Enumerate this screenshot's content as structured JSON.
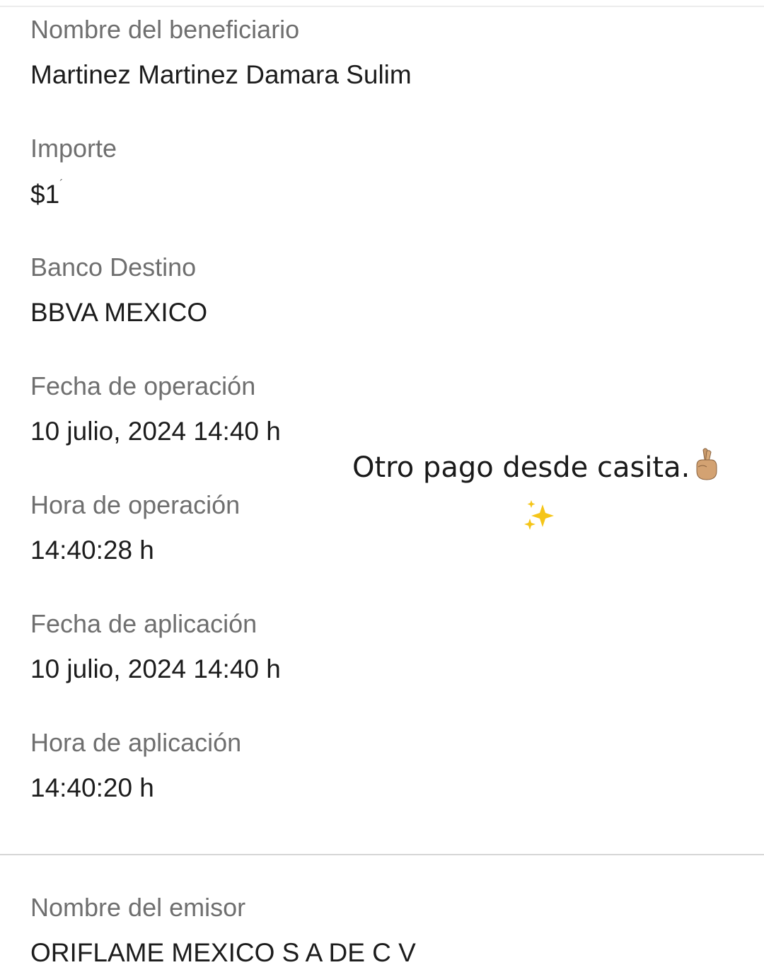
{
  "fields": [
    {
      "label": "Nombre del beneficiario",
      "value": "Martinez Martinez Damara Sulim"
    },
    {
      "label": "Importe",
      "value": "$1"
    },
    {
      "label": "Banco Destino",
      "value": "BBVA MEXICO"
    },
    {
      "label": "Fecha de operación",
      "value": "10 julio, 2024 14:40 h"
    },
    {
      "label": "Hora de operación",
      "value": "14:40:28 h"
    },
    {
      "label": "Fecha de aplicación",
      "value": "10 julio, 2024 14:40 h"
    },
    {
      "label": "Hora de aplicación",
      "value": "14:40:20 h"
    },
    {
      "label": "Nombre del emisor",
      "value": "ORIFLAME MEXICO S A DE C V"
    }
  ],
  "overlay": {
    "text": "Otro pago desde casita.",
    "emoji_1": "crossed-fingers-icon",
    "emoji_2": "sparkles-icon"
  },
  "colors": {
    "label": "#6f6f6f",
    "value": "#1c1c1c",
    "divider": "#d6d6d6",
    "sparkle": "#f5c518"
  }
}
